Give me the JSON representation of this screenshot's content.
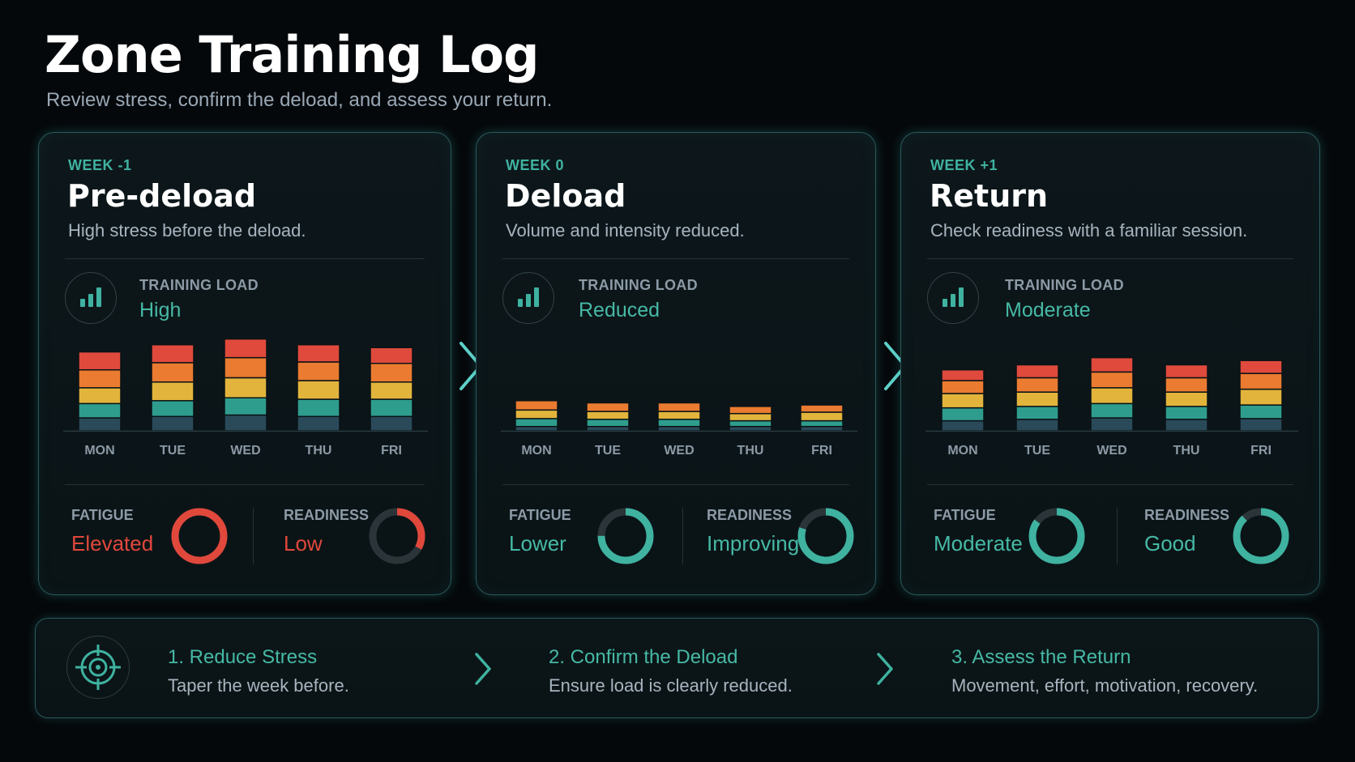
{
  "header": {
    "title": "Zone Training Log",
    "subtitle": "Review stress, confirm the deload, and assess your return."
  },
  "colors": {
    "accent": "#3fb2a0",
    "stack": [
      "#2a4a5a",
      "#2f9d8e",
      "#e2b43c",
      "#ea7b30",
      "#e04a3c"
    ],
    "elevated": "#e0483c",
    "good": "#3fb2a0"
  },
  "weeks": [
    {
      "week": "WEEK -1",
      "phase": "Pre-deload",
      "description": "High stress before the deload.",
      "load_label": "TRAINING LOAD",
      "load_value": "High",
      "fatigue_label": "FATIGUE",
      "fatigue_value": "Elevated",
      "fatigue_level": 1.0,
      "readiness_label": "READINESS",
      "readiness_value": "Low",
      "readiness_level": 0.33
    },
    {
      "week": "WEEK 0",
      "phase": "Deload",
      "description": "Volume and intensity reduced.",
      "load_label": "TRAINING LOAD",
      "load_value": "Reduced",
      "fatigue_label": "FATIGUE",
      "fatigue_value": "Lower",
      "fatigue_level": 0.75,
      "readiness_label": "READINESS",
      "readiness_value": "Improving",
      "readiness_level": 0.8
    },
    {
      "week": "WEEK +1",
      "phase": "Return",
      "description": "Check readiness with a familiar session.",
      "load_label": "TRAINING LOAD",
      "load_value": "Moderate",
      "fatigue_label": "FATIGUE",
      "fatigue_value": "Moderate",
      "fatigue_level": 0.85,
      "readiness_label": "READINESS",
      "readiness_value": "Good",
      "readiness_level": 0.88
    }
  ],
  "chart_data": [
    {
      "type": "bar",
      "stacked": true,
      "categories": [
        "MON",
        "TUE",
        "WED",
        "THU",
        "FRI"
      ],
      "ylim": [
        0,
        140
      ],
      "series": [
        {
          "values": [
            18,
            20,
            22,
            20,
            20
          ]
        },
        {
          "values": [
            20,
            22,
            24,
            24,
            24
          ]
        },
        {
          "values": [
            22,
            26,
            28,
            26,
            24
          ]
        },
        {
          "values": [
            25,
            27,
            28,
            26,
            26
          ]
        },
        {
          "values": [
            25,
            25,
            26,
            24,
            22
          ]
        }
      ]
    },
    {
      "type": "bar",
      "stacked": true,
      "categories": [
        "MON",
        "TUE",
        "WED",
        "THU",
        "FRI"
      ],
      "ylim": [
        0,
        140
      ],
      "series": [
        {
          "values": [
            6,
            6,
            6,
            6,
            6
          ]
        },
        {
          "values": [
            11,
            10,
            10,
            8,
            8
          ]
        },
        {
          "values": [
            12,
            11,
            11,
            10,
            12
          ]
        },
        {
          "values": [
            13,
            12,
            12,
            10,
            10
          ]
        },
        {
          "values": [
            0,
            0,
            0,
            0,
            0
          ]
        }
      ]
    },
    {
      "type": "bar",
      "stacked": true,
      "categories": [
        "MON",
        "TUE",
        "WED",
        "THU",
        "FRI"
      ],
      "ylim": [
        0,
        140
      ],
      "series": [
        {
          "values": [
            14,
            16,
            18,
            16,
            17
          ]
        },
        {
          "values": [
            18,
            18,
            20,
            18,
            19
          ]
        },
        {
          "values": [
            20,
            20,
            22,
            20,
            22
          ]
        },
        {
          "values": [
            18,
            20,
            22,
            20,
            22
          ]
        },
        {
          "values": [
            15,
            18,
            20,
            18,
            18
          ]
        }
      ]
    }
  ],
  "steps": {
    "icon": "target-icon",
    "items": [
      {
        "title": "1. Reduce Stress",
        "description": "Taper the week before."
      },
      {
        "title": "2. Confirm the Deload",
        "description": "Ensure load is clearly reduced."
      },
      {
        "title": "3. Assess the Return",
        "description": "Movement, effort, motivation, recovery."
      }
    ]
  }
}
